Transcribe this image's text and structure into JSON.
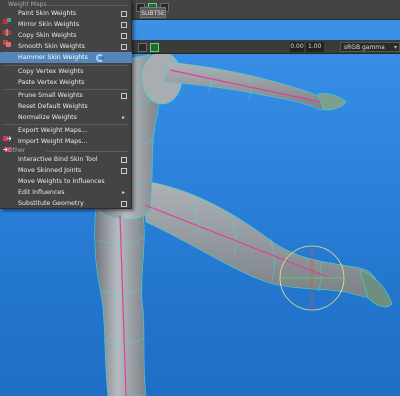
{
  "menu": {
    "section_weight_maps": "Weight Maps",
    "section_other": "Other",
    "items": [
      {
        "label": "Paint Skin Weights",
        "icon": "paint-weights-icon",
        "has_options": true
      },
      {
        "label": "Mirror Skin Weights",
        "icon": "mirror-weights-icon",
        "has_options": true
      },
      {
        "label": "Copy Skin Weights",
        "icon": "copy-weights-icon",
        "has_options": true
      },
      {
        "label": "Smooth Skin Weights",
        "icon": "smooth-weights-icon",
        "has_options": true
      },
      {
        "label": "Hammer Skin Weights",
        "icon": "",
        "has_options": false,
        "highlighted": true
      },
      {
        "label": "Copy Vertex Weights",
        "icon": "",
        "has_options": false
      },
      {
        "label": "Paste Vertex Weights",
        "icon": "",
        "has_options": false
      },
      {
        "label": "Prune Small Weights",
        "icon": "",
        "has_options": true
      },
      {
        "label": "Reset Default Weights",
        "icon": "",
        "has_options": false
      },
      {
        "label": "Normalize Weights",
        "icon": "",
        "has_submenu": true
      },
      {
        "label": "Export Weight Maps...",
        "icon": "export-weights-icon",
        "has_options": false
      },
      {
        "label": "Import Weight Maps...",
        "icon": "import-weights-icon",
        "has_options": false
      },
      {
        "label": "Interactive Bind Skin Tool",
        "icon": "",
        "has_options": true
      },
      {
        "label": "Move Skinned Joints",
        "icon": "",
        "has_options": true
      },
      {
        "label": "Move Weights to Influences",
        "icon": "",
        "has_options": false
      },
      {
        "label": "Edit Influences",
        "icon": "",
        "has_submenu": true
      },
      {
        "label": "Substitute Geometry",
        "icon": "",
        "has_options": true
      }
    ]
  },
  "viewport": {
    "tab_label": "SUBTSE",
    "frame_field": "0.00",
    "frame_value": "1.00",
    "colorspace": "sRGB gamma"
  },
  "colors": {
    "menu_bg": "#444444",
    "highlight": "#5486b8",
    "viewport_top": "#3e93e8",
    "viewport_bottom": "#1e6ec4",
    "wire": "#38e6e0",
    "mesh": "#9aa0a4"
  }
}
